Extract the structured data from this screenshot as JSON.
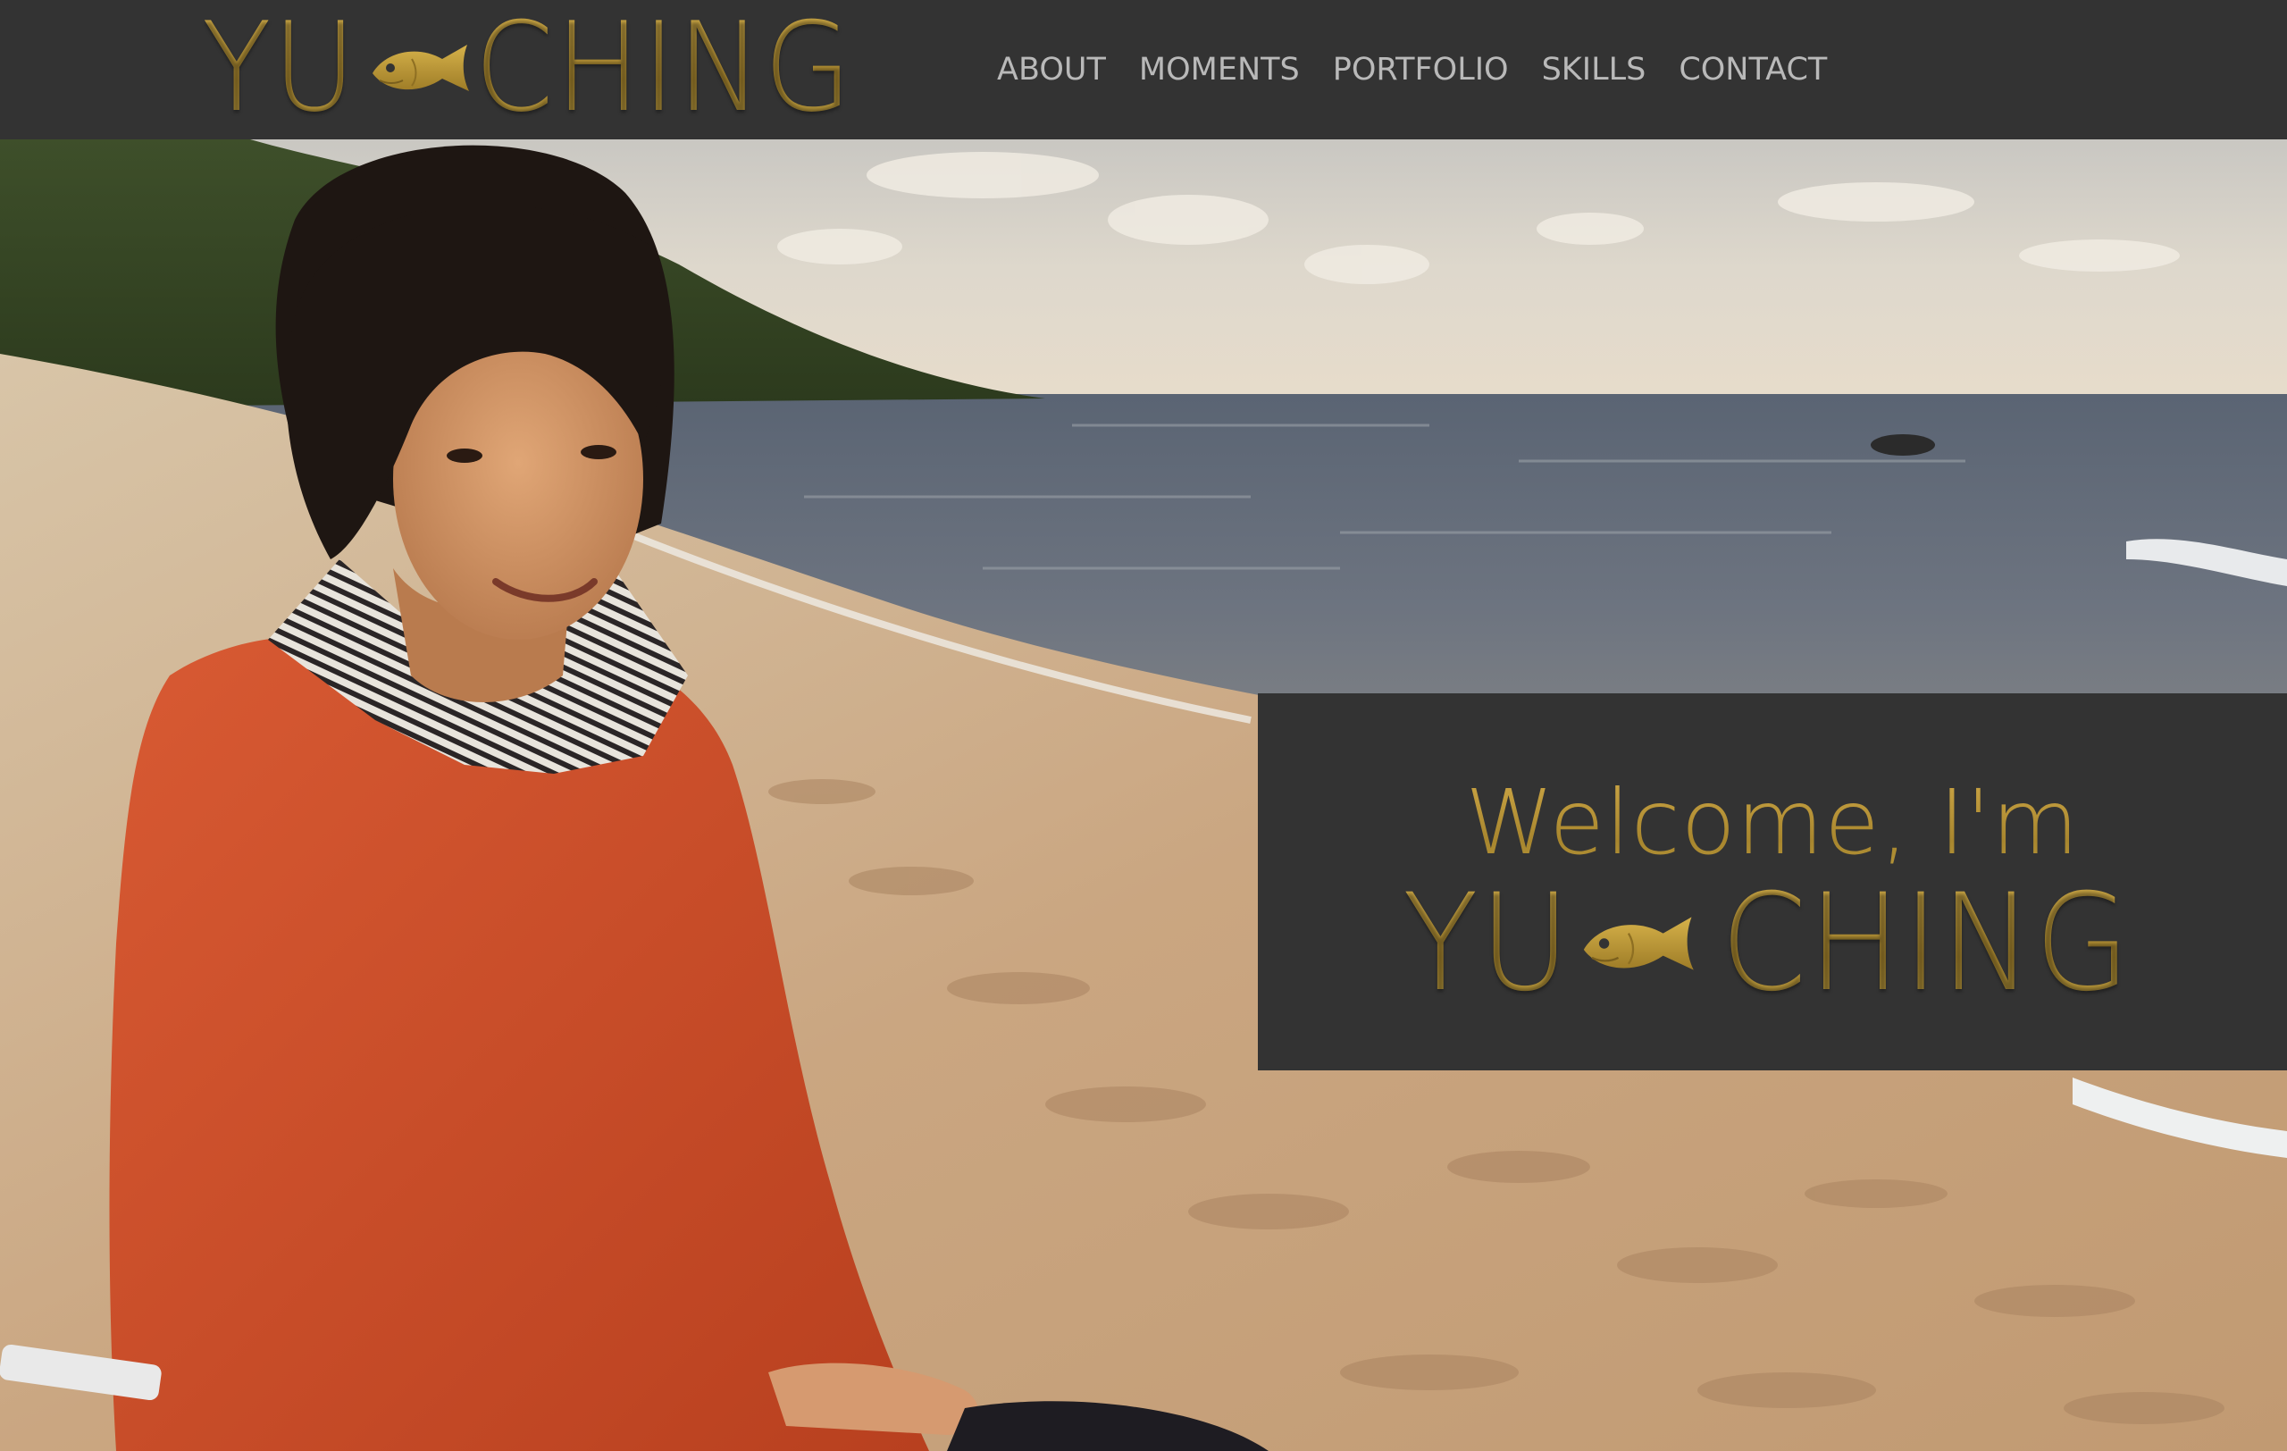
{
  "header": {
    "logo": {
      "text_left": "YU",
      "text_right": "CHING",
      "icon": "fish-icon"
    },
    "nav": [
      {
        "label": "ABOUT"
      },
      {
        "label": "MOMENTS"
      },
      {
        "label": "PORTFOLIO"
      },
      {
        "label": "SKILLS"
      },
      {
        "label": "CONTACT"
      }
    ]
  },
  "hero": {
    "image": "beach-portrait-photo",
    "welcome": {
      "greeting": "Welcome, I'm",
      "name_left": "YU",
      "name_right": "CHING",
      "icon": "fish-icon"
    }
  },
  "colors": {
    "header_bg": "#333333",
    "gold": "#b8963a",
    "nav_text": "#b9b9b9"
  }
}
